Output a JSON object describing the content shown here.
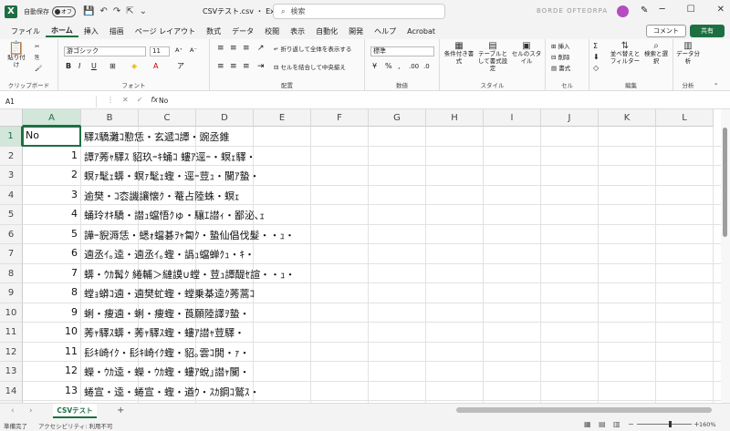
{
  "titlebar": {
    "app_icon": "excel-icon",
    "autosave_label": "自動保存",
    "autosave_state": "オフ",
    "doc_title": "CSVテスト.csv ・ Excel",
    "search_placeholder": "検索",
    "user_name": "BORDE OFTEORPA",
    "minimize": "─",
    "maximize": "☐",
    "close": "✕"
  },
  "menu": {
    "tabs": [
      "ファイル",
      "ホーム",
      "挿入",
      "描画",
      "ページ レイアウト",
      "数式",
      "データ",
      "校閲",
      "表示",
      "自動化",
      "開発",
      "ヘルプ",
      "Acrobat"
    ],
    "active_tab": 1,
    "comment_label": "コメント",
    "share_label": "共有"
  },
  "ribbon": {
    "clipboard": {
      "paste": "貼り付け",
      "label": "クリップボード"
    },
    "font": {
      "name": "游ゴシック",
      "size": "11",
      "label": "フォント"
    },
    "alignment": {
      "wrap": "折り返して全体を表示する",
      "merge": "セルを結合して中央揃え",
      "label": "配置"
    },
    "number": {
      "format": "標準",
      "label": "数値"
    },
    "styles": {
      "conditional": "条件付き書式",
      "table": "テーブルとして書式設定",
      "cell": "セルのスタイル",
      "label": "スタイル"
    },
    "cells": {
      "insert": "挿入",
      "delete": "削除",
      "format": "書式",
      "label": "セル"
    },
    "editing": {
      "sort": "並べ替えとフィルター",
      "find": "検索と選択",
      "label": "編集"
    },
    "analysis": {
      "analyze": "データ分析",
      "label": "分析"
    }
  },
  "formula_bar": {
    "name_box": "A1",
    "value": "No"
  },
  "sheet": {
    "columns": [
      "A",
      "B",
      "C",
      "D",
      "E",
      "F",
      "G",
      "H",
      "I",
      "J",
      "K",
      "L"
    ],
    "selected_column": "A",
    "selected_row": 1,
    "header_row": {
      "a": "No",
      "b": "驛ｽ驕灘ｺ懃恁・玄遞ｺ譚・豌丞錐"
    },
    "rows": [
      {
        "no": "1",
        "text": "譚ｱ莠ｬ驛ｽ 貂玖ｰｷ蛹ｺ 螻ｱ逕ｰ・螟ｪ驛・"
      },
      {
        "no": "2",
        "text": "螟ｧ髦ｪ蠎・螟ｧ髦ｪ蟶・逕ｰ荳ｭ・闃ｱ蟄・"
      },
      {
        "no": "3",
        "text": "逾樊・ｺ枩譏讓懐ｸ・菴占陸蛛・螟ｪ"
      },
      {
        "no": "4",
        "text": "蛹玲ｵｷ驕・譛ｭ蟷悟ｸゅ・驤ｴ譛ｨ・鄙泌､ｪ"
      },
      {
        "no": "5",
        "text": "譁ｰ貎溽恁・蟋ｫ蟷碁ｦｬ匐ｸ・蟄仙倡伐髮・・ｭ・"
      },
      {
        "no": "6",
        "text": "遖丞ｲ｡逵・遖丞ｲ｡蟶・譌ｭ蟷蝉ｸｭ・ｷ・"
      },
      {
        "no": "7",
        "text": "蠎・ｳｶ髯ｸ 綣輔＞縺謨∪螳・荳ｭ譚醍ｾ諠・・ｭ・"
      },
      {
        "no": "8",
        "text": "螳ｮ蟒ｺ遖・遖樊虻蟶・螳乗棊逵ｸ莠蒿ｺ"
      },
      {
        "no": "9",
        "text": "蜊・痩遖・蜊・痩蟶・莨願陸譯ｦ蟄・"
      },
      {
        "no": "10",
        "text": "莠ｬ驛ｽ蠎・莠ｬ驛ｽ蟶・螻ｱ譛ｬ荳驛・"
      },
      {
        "no": "11",
        "text": "髟ｷ崎ｲｸ・髟ｷ崎ｲｸ蟶・貂｡雲ｺ閧・ｧ・"
      },
      {
        "no": "12",
        "text": "蠑・ｳｶ逵・蠑・ｳｶ蟶・螻ｱ蛻｣譛ｬ闃・"
      },
      {
        "no": "13",
        "text": "蜷宣・逵・蜷宣・蟶・遒ｳ・ｽｶ鋼ｺ鷲ｽ・"
      },
      {
        "no": "14",
        "text": "闖ｨ蝓朱ｿ・蟲郁ｽ・蜈･霖・譚ｸ・醐"
      }
    ]
  },
  "sheet_tabs": {
    "prev": "‹",
    "next": "›",
    "active": "CSVテスト",
    "add": "+"
  },
  "status": {
    "ready": "準備完了",
    "accessibility": "アクセシビリティ: 利用不可",
    "zoom_label": "160%",
    "zoom_percent": 160
  }
}
